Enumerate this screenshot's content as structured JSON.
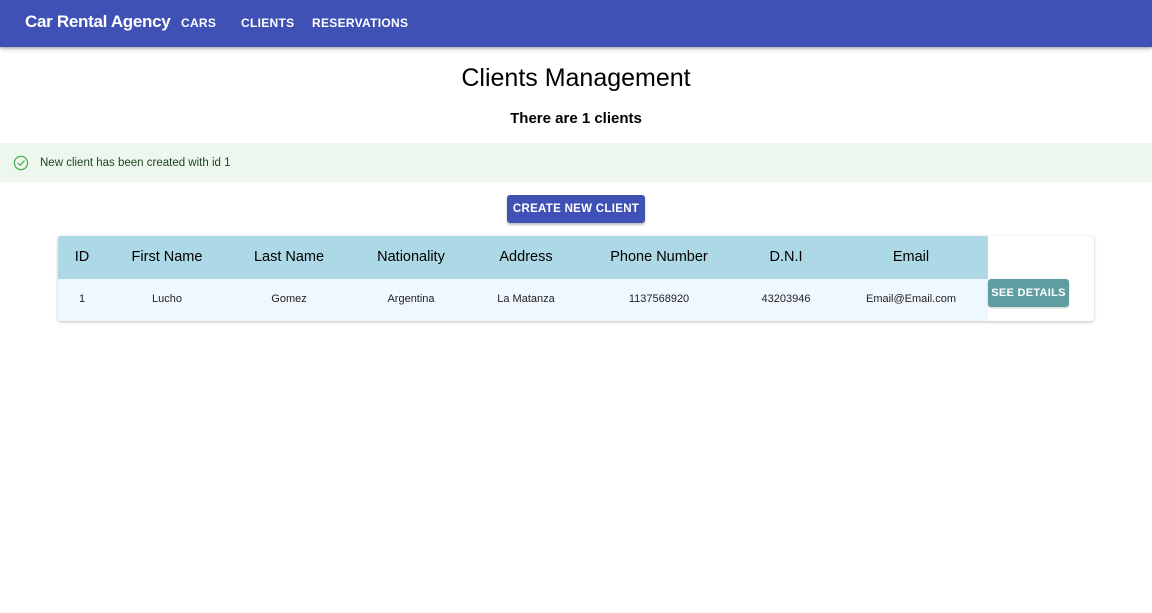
{
  "app": {
    "brand": "Car Rental Agency",
    "nav": [
      {
        "label": "CARS"
      },
      {
        "label": "CLIENTS"
      },
      {
        "label": "RESERVATIONS"
      }
    ]
  },
  "page": {
    "title": "Clients Management",
    "subtitle": "There are 1 clients"
  },
  "alert": {
    "severity": "success",
    "icon": "check-circle-icon",
    "message": "New client has been created with id 1"
  },
  "actions": {
    "create_label": "CREATE NEW CLIENT"
  },
  "table": {
    "columns": [
      "ID",
      "First Name",
      "Last Name",
      "Nationality",
      "Address",
      "Phone Number",
      "D.N.I",
      "Email"
    ],
    "rows": [
      {
        "id": "1",
        "first_name": "Lucho",
        "last_name": "Gomez",
        "nationality": "Argentina",
        "address": "La Matanza",
        "phone": "1137568920",
        "dni": "43203946",
        "email": "Email@Email.com",
        "details_label": "SEE DETAILS"
      }
    ]
  },
  "colors": {
    "appbar": "#3f51b5",
    "primary_button": "#3f51b5",
    "details_button": "#5f9ea0",
    "table_header": "#add8e6",
    "table_row": "#f0f8ff",
    "alert_bg": "#edf7ed",
    "alert_icon": "#4caf50"
  }
}
